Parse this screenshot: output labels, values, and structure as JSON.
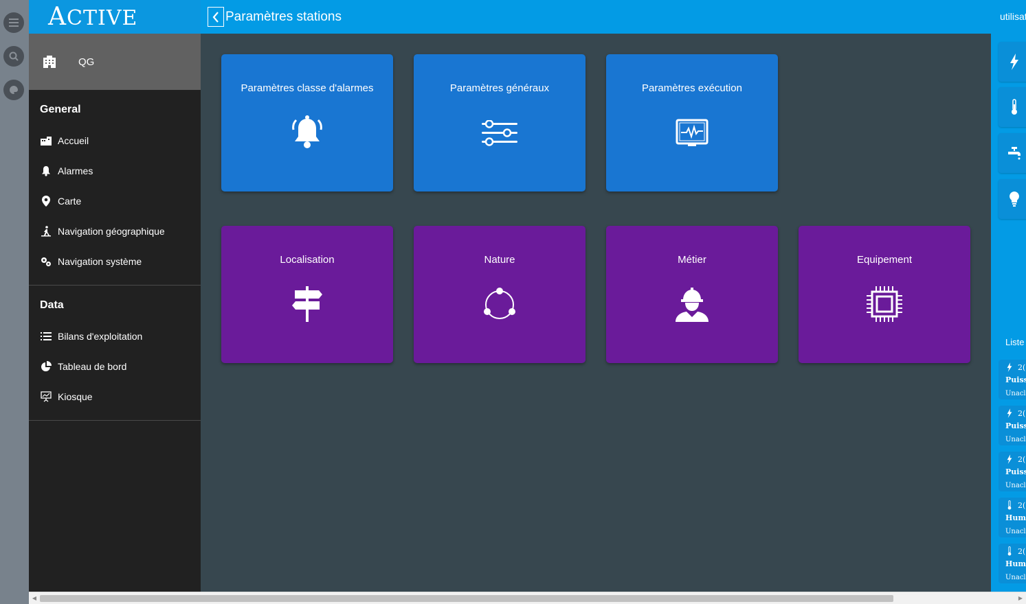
{
  "app": {
    "logo_initial": "A",
    "logo_rest": "CTIVE"
  },
  "header": {
    "title": "Paramètres stations",
    "user": "utilisateur"
  },
  "sidebar": {
    "site": "QG",
    "sections": [
      {
        "title": "General",
        "items": [
          "Accueil",
          "Alarmes",
          "Carte",
          "Navigation géographique",
          "Navigation système"
        ]
      },
      {
        "title": "Data",
        "items": [
          "Bilans d'exploitation",
          "Tableau de bord",
          "Kiosque"
        ]
      }
    ]
  },
  "tiles": [
    {
      "label": "Paramètres classe d'alarmes",
      "icon": "bell-icon",
      "color": "#1976d2"
    },
    {
      "label": "Paramètres généraux",
      "icon": "sliders-icon",
      "color": "#1976d2"
    },
    {
      "label": "Paramètres exécution",
      "icon": "monitor-pulse-icon",
      "color": "#1976d2"
    },
    {
      "label": "Localisation",
      "icon": "signpost-icon",
      "color": "#6a1b9a"
    },
    {
      "label": "Nature",
      "icon": "cycle-icon",
      "color": "#6a1b9a"
    },
    {
      "label": "Métier",
      "icon": "worker-icon",
      "color": "#6a1b9a"
    },
    {
      "label": "Equipement",
      "icon": "chip-icon",
      "color": "#6a1b9a"
    }
  ],
  "right_panel": {
    "filters": [
      "lightning-icon",
      "thermometer-icon",
      "faucet-icon",
      "bulb-icon"
    ],
    "list_label": "Liste",
    "alarms": [
      {
        "icon": "lightning-icon",
        "year": "2(",
        "name": "Puiss",
        "status": "Unacl"
      },
      {
        "icon": "lightning-icon",
        "year": "2(",
        "name": "Puiss",
        "status": "Unacl"
      },
      {
        "icon": "lightning-icon",
        "year": "2(",
        "name": "Puiss",
        "status": "Unacl"
      },
      {
        "icon": "thermometer-icon",
        "year": "2(",
        "name": "Humi",
        "status": "Unacl"
      },
      {
        "icon": "thermometer-icon",
        "year": "2(",
        "name": "Humi",
        "status": "Unacl"
      }
    ]
  }
}
